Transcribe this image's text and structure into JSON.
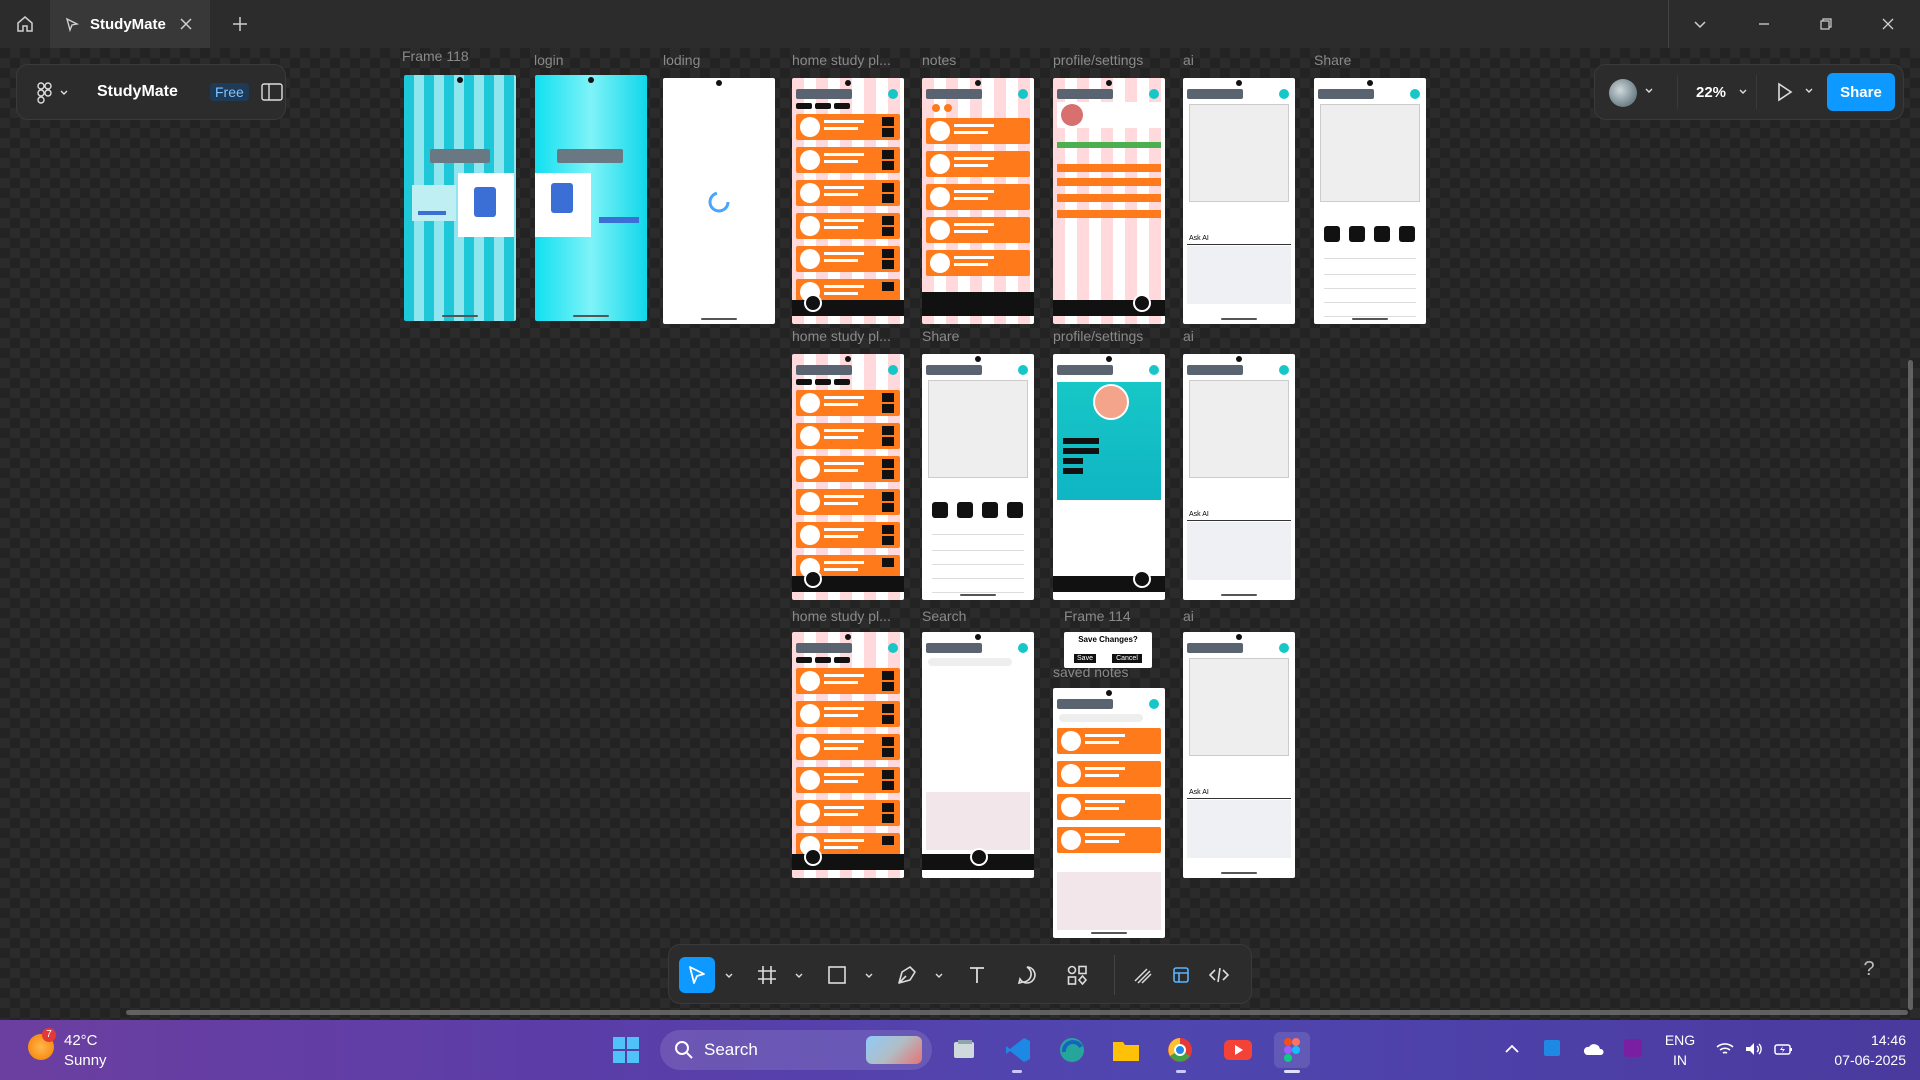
{
  "window": {
    "tab_title": "StudyMate"
  },
  "project": {
    "name": "StudyMate",
    "plan_badge": "Free"
  },
  "right_panel": {
    "zoom": "22%",
    "share_label": "Share"
  },
  "frames": {
    "frame118": "Frame 118",
    "login": "login",
    "loding": "loding",
    "home1": "home study pl...",
    "notes": "notes",
    "profile1": "profile/settings",
    "ai1": "ai",
    "share1": "Share",
    "home2": "home study pl...",
    "share2": "Share",
    "profile2": "profile/settings",
    "ai2": "ai",
    "home3": "home study pl...",
    "search": "Search",
    "frame114": "Frame 114",
    "saved": "saved notes",
    "ai3": "ai"
  },
  "dialog": {
    "title": "Save Changes?",
    "save": "Save",
    "cancel": "Cancel"
  },
  "phone_text": {
    "ask_ai": "Ask AI"
  },
  "help": "?",
  "taskbar": {
    "weather_badge": "7",
    "temperature": "42°C",
    "condition": "Sunny",
    "search_label": "Search",
    "lang1": "ENG",
    "lang2": "IN",
    "time": "14:46",
    "date": "07-06-2025"
  },
  "colors": {
    "accent": "#0d99ff",
    "card_orange": "#ff7a1a",
    "teal": "#17c7c7"
  }
}
